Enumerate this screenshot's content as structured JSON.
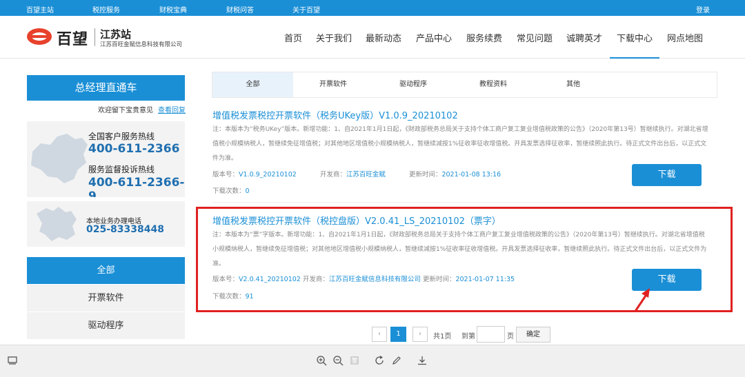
{
  "topbar": {
    "links": [
      "百望主站",
      "税控服务",
      "财税宝典",
      "财税问答",
      "关于百望"
    ],
    "login": "登录"
  },
  "header": {
    "logo_text": "百望",
    "site_name": "江苏站",
    "company": "江苏百旺金赋信息科技有限公司",
    "nav": [
      "首页",
      "关于我们",
      "最新动态",
      "产品中心",
      "服务续费",
      "常见问题",
      "诚聘英才",
      "下载中心",
      "网点地图"
    ],
    "active_nav": "下载中心"
  },
  "sidebar": {
    "title": "总经理直通车",
    "feedback_text": "欢迎留下宝贵意见",
    "feedback_link": "查看回复",
    "hotline_label": "全国客户服务热线",
    "hotline": "400-611-2366",
    "complaint_label": "服务监督投诉热线",
    "complaint": "400-611-2366-9",
    "local_label": "本地业务办理电话",
    "local_phone": "025-83338448",
    "categories": [
      "全部",
      "开票软件",
      "驱动程序"
    ]
  },
  "tabs": [
    "全部",
    "开票软件",
    "驱动程序",
    "教程资料",
    "其他"
  ],
  "items": [
    {
      "title": "增值税发票税控开票软件（税务UKey版）V1.0.9_20210102",
      "desc": "注：本版本为“税务UKey”版本。新增功能：1、自2021年1月1日起，《财政部税务总局关于支持个体工商户复工复业增值税政策的公告》（2020年第13号）暂继续执行。对湖北省增值税小规模纳税人，暂继续免征增值税；对其他地区增值税小规模纳税人，暂继续减按1%征收率征收增值税。开具发票选择征收率，暂继续照此执行。待正式文件出台后，以正式文件为准。",
      "version_label": "版本号：",
      "version": "V1.0.9_20210102",
      "dev_label": "开发商：",
      "dev": "江苏百旺金赋",
      "time_label": "更新时间：",
      "time": "2021-01-08 13:16",
      "count_label": "下载次数：",
      "count": "0",
      "button": "下载"
    },
    {
      "title": "增值税发票税控开票软件（税控盘版）V2.0.41_LS_20210102（票字）",
      "desc": "注：本版本为“票”字版本。新增功能：1、自2021年1月1日起，《财政部税务总局关于支持个体工商户复工复业增值税政策的公告》（2020年第13号）暂继续执行。对湖北省增值税小规模纳税人，暂继续免征增值税；对其他地区增值税小规模纳税人，暂继续减按1%征收率征收增值税。开具发票选择征收率，暂继续照此执行。待正式文件出台后，以正式文件为准。",
      "version_label": "版本号：",
      "version": "V2.0.41_20210102",
      "dev_label": "开发商：",
      "dev": "江苏百旺金赋信息科技有限公司",
      "time_label": "更新时间：",
      "time": "2021-01-07 11:35",
      "count_label": "下载次数：",
      "count": "91",
      "button": "下载"
    }
  ],
  "pager": {
    "prev": "‹",
    "current": "1",
    "next": "›",
    "total": "共1页",
    "goto": "到第",
    "page_unit": "页",
    "confirm": "确定"
  },
  "colors": {
    "brand": "#1a8fd6",
    "highlight": "#e02020",
    "logo": "#e8412c"
  }
}
